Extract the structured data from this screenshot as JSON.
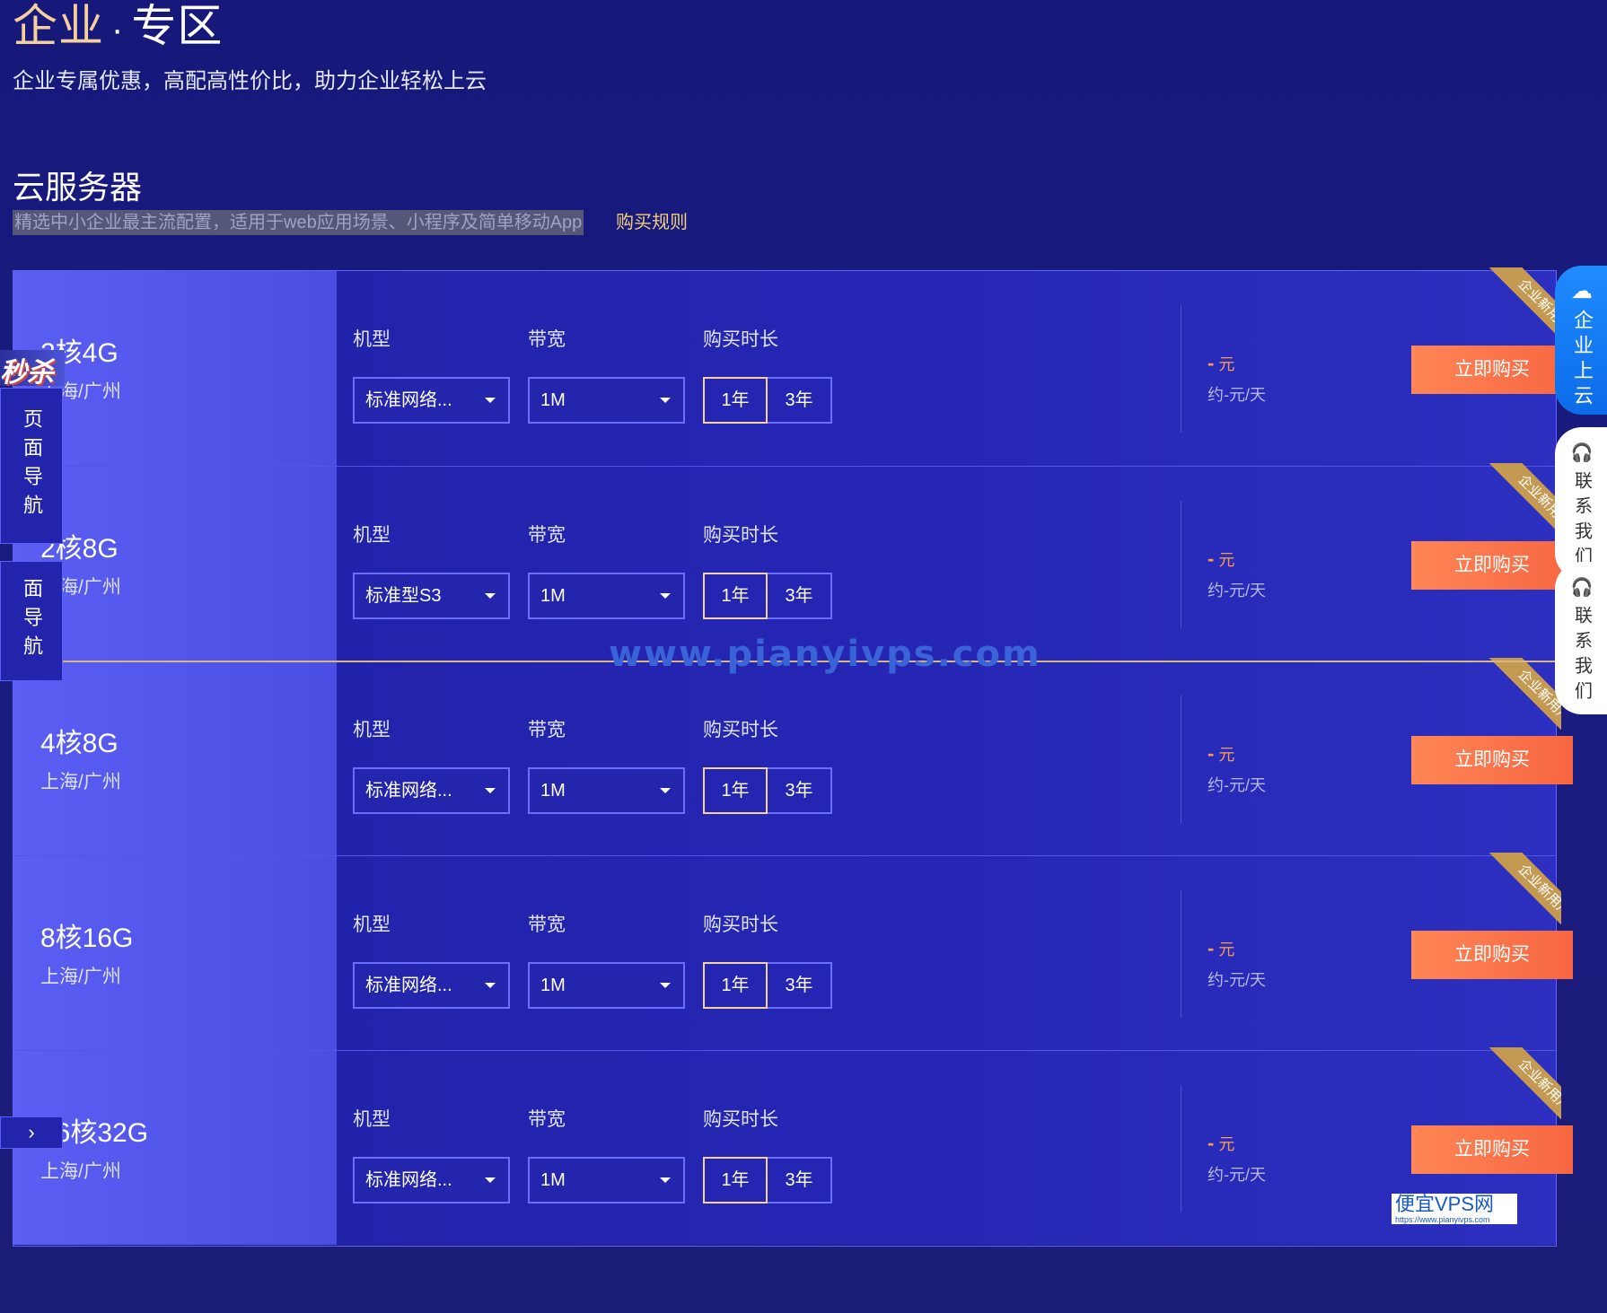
{
  "hero": {
    "title_a": "企业",
    "title_dot": "·",
    "title_b": "专区",
    "subtitle": "企业专属优惠，高配高性价比，助力企业轻松上云"
  },
  "section": {
    "title": "云服务器",
    "desc": "精选中小企业最主流配置，适用于web应用场景、小程序及简单移动App",
    "rules_link": "购买规则"
  },
  "labels": {
    "model": "机型",
    "bandwidth": "带宽",
    "duration": "购买时长",
    "buy": "立即购买",
    "ribbon": "企业新用户"
  },
  "rows": [
    {
      "spec": "2核4G",
      "region": "上海/广州",
      "model": "标准网络...",
      "bandwidth": "1M",
      "dur1": "1年",
      "dur2": "3年",
      "price": "元",
      "price_dash": "-",
      "perday": "约-元/天"
    },
    {
      "spec": "2核8G",
      "region": "上海/广州",
      "model": "标准型S3",
      "bandwidth": "1M",
      "dur1": "1年",
      "dur2": "3年",
      "price": "元",
      "price_dash": "-",
      "perday": "约-元/天"
    },
    {
      "spec": "4核8G",
      "region": "上海/广州",
      "model": "标准网络...",
      "bandwidth": "1M",
      "dur1": "1年",
      "dur2": "3年",
      "price": "元",
      "price_dash": "-",
      "perday": "约-元/天"
    },
    {
      "spec": "8核16G",
      "region": "上海/广州",
      "model": "标准网络...",
      "bandwidth": "1M",
      "dur1": "1年",
      "dur2": "3年",
      "price": "元",
      "price_dash": "-",
      "perday": "约-元/天"
    },
    {
      "spec": "16核32G",
      "region": "上海/广州",
      "model": "标准网络...",
      "bandwidth": "1M",
      "dur1": "1年",
      "dur2": "3年",
      "price": "元",
      "price_dash": "-",
      "perday": "约-元/天"
    }
  ],
  "left_nav": {
    "label": "页面导航",
    "label2": "面导航",
    "arrow": "›",
    "badge": "秒杀"
  },
  "side": {
    "cloud": "企业上云",
    "contact": "联系我们",
    "cloud_icon": "cloud-icon",
    "contact_icon": "headset-icon"
  },
  "watermark": {
    "text": "www.pianyivps.com",
    "badge": "便宜VPS网",
    "badge_url": "https://www.pianyivps.com"
  }
}
